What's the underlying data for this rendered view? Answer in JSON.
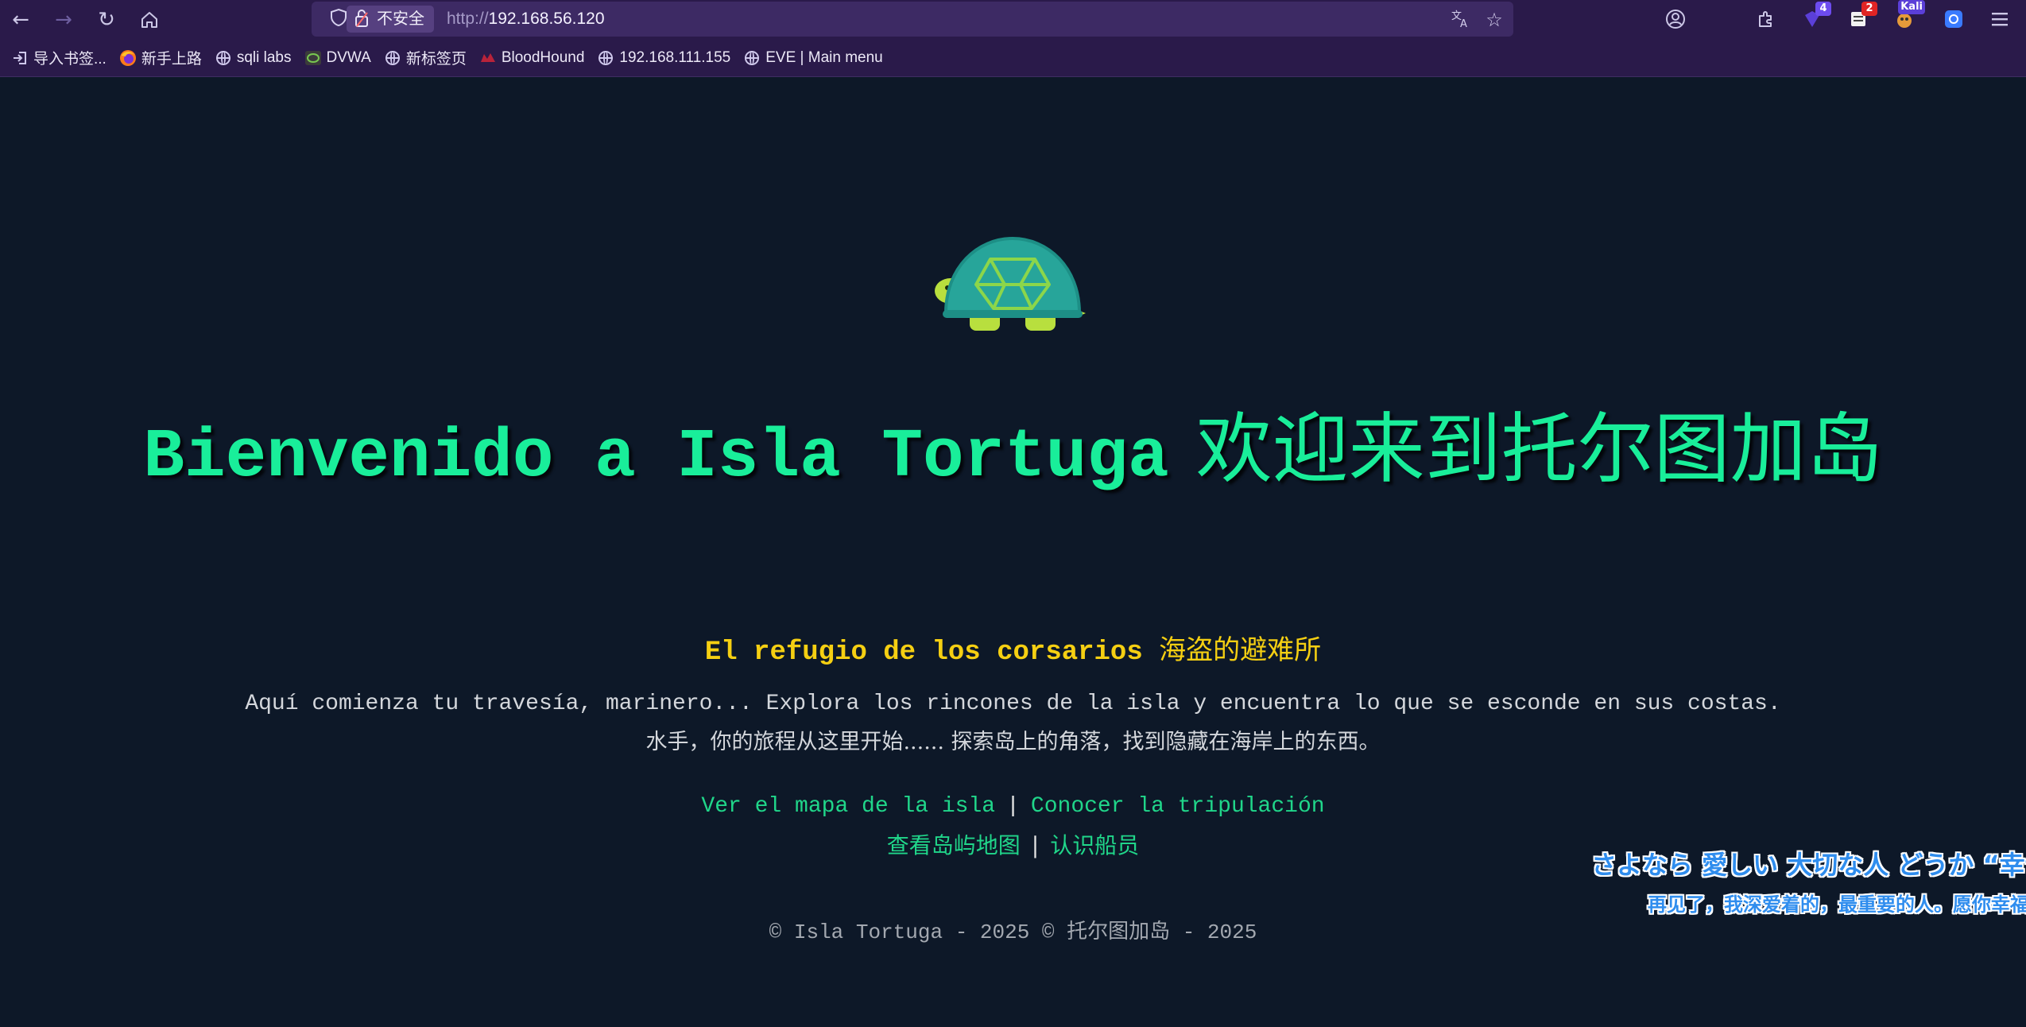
{
  "browser": {
    "url_protocol": "http://",
    "url_host": "192.168.56.120",
    "security_label": "不安全",
    "extension_badges": [
      "4",
      "2",
      "Kali"
    ],
    "bookmarks": [
      {
        "label": "导入书签...",
        "icon": "import-icon"
      },
      {
        "label": "新手上路",
        "icon": "firefox-icon"
      },
      {
        "label": "sqli labs",
        "icon": "globe-icon"
      },
      {
        "label": "DVWA",
        "icon": "dvwa-icon"
      },
      {
        "label": "新标签页",
        "icon": "globe-icon"
      },
      {
        "label": "BloodHound",
        "icon": "bloodhound-icon"
      },
      {
        "label": "192.168.111.155",
        "icon": "globe-icon"
      },
      {
        "label": "EVE | Main menu",
        "icon": "globe-icon"
      }
    ]
  },
  "page": {
    "hero_es": "Bienvenido a Isla Tortuga",
    "hero_zh": "欢迎来到托尔图加岛",
    "subtitle_es": "El refugio de los corsarios",
    "subtitle_zh": "海盗的避难所",
    "para_es": "Aquí comienza tu travesía, marinero... Explora los rincones de la isla y encuentra lo que se esconde en sus costas.",
    "para_zh": "水手，你的旅程从这里开始...... 探索岛上的角落，找到隐藏在海岸上的东西。",
    "links_es": [
      "Ver el mapa de la isla",
      "Conocer la tripulación"
    ],
    "links_zh": [
      "查看岛屿地图",
      "认识船员"
    ],
    "separator": "|",
    "footer": "© Isla Tortuga - 2025 © 托尔图加岛 - 2025"
  },
  "overlay": {
    "lyric_jp": "さよなら 愛しい 大切な人 どうか “幸せに”",
    "lyric_zh": "再见了，我深爱着的，最重要的人。愿你幸福"
  },
  "colors": {
    "background": "#0d1828",
    "hero": "#19ee9a",
    "subtitle": "#f5cf12",
    "link": "#20d68a",
    "chrome": "#2a1a4a"
  }
}
